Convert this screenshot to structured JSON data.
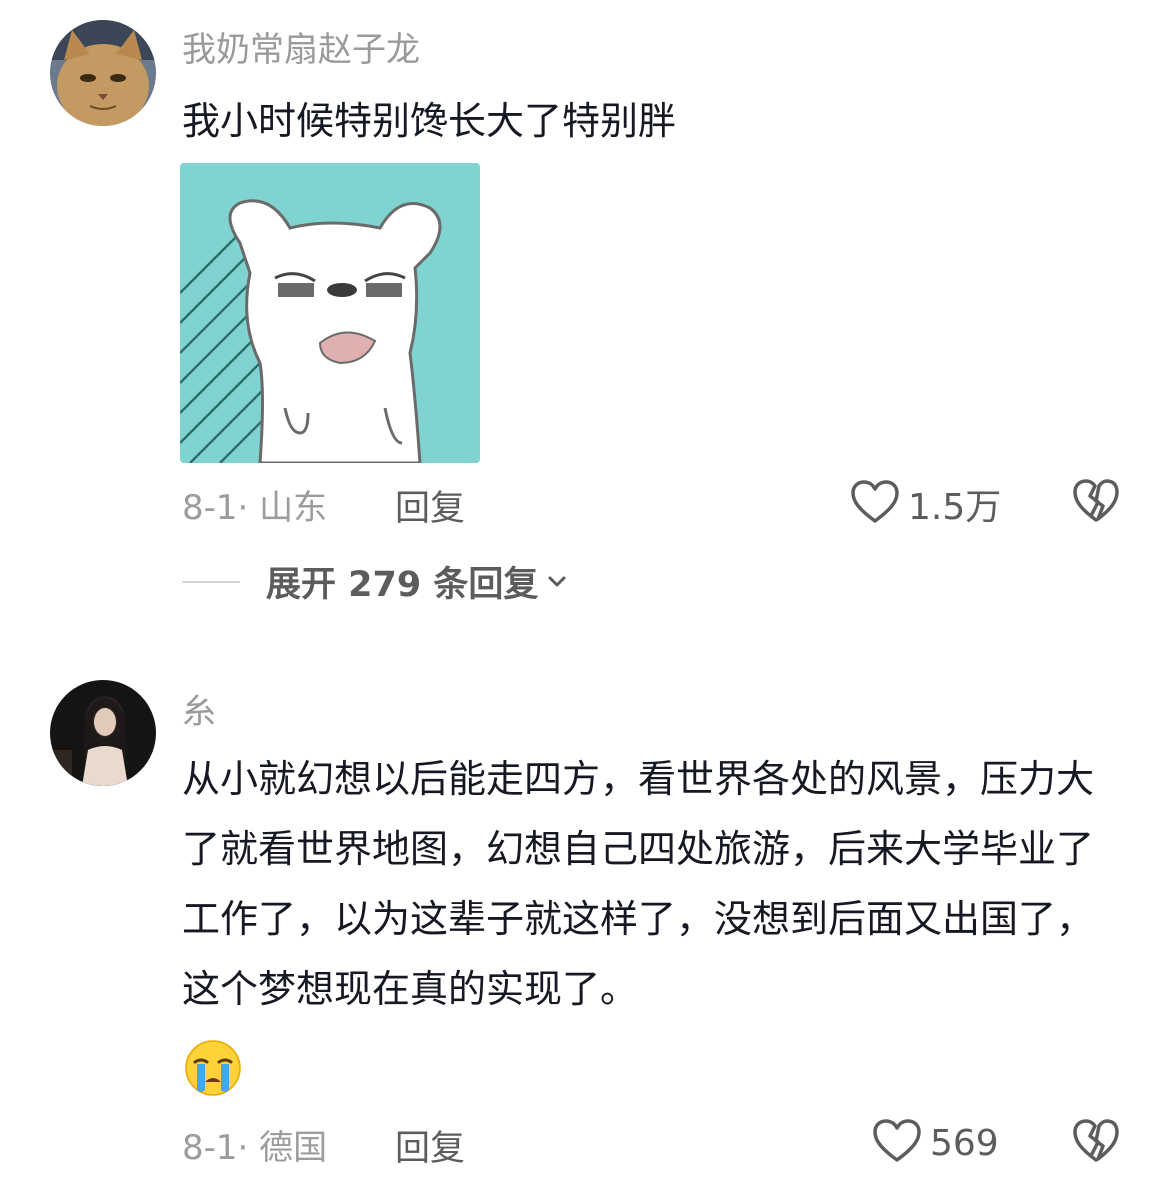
{
  "comments": [
    {
      "username": "我奶常扇赵子龙",
      "text": "我小时候特别馋长大了特别胖",
      "date_location": "8-1· 山东",
      "reply_label": "回复",
      "likes": "1.5万",
      "expand_label": "展开 279 条回复"
    },
    {
      "username": "糸",
      "text": "从小就幻想以后能走四方，看世界各处的风景，压力大了就看世界地图，幻想自己四处旅游，后来大学毕业了工作了，以为这辈子就这样了，没想到后面又出国了，这个梦想现在真的实现了。",
      "date_location": "8-1· 德国",
      "reply_label": "回复",
      "likes": "569"
    }
  ],
  "icons": {
    "like": "heart-outline-icon",
    "dislike": "broken-heart-icon",
    "expand": "chevron-down-icon",
    "emoji": "crying-face-emoji"
  },
  "colors": {
    "sticker_bg": "#7fd3d0",
    "text_primary": "#161823",
    "text_secondary": "#9c9c9c"
  }
}
